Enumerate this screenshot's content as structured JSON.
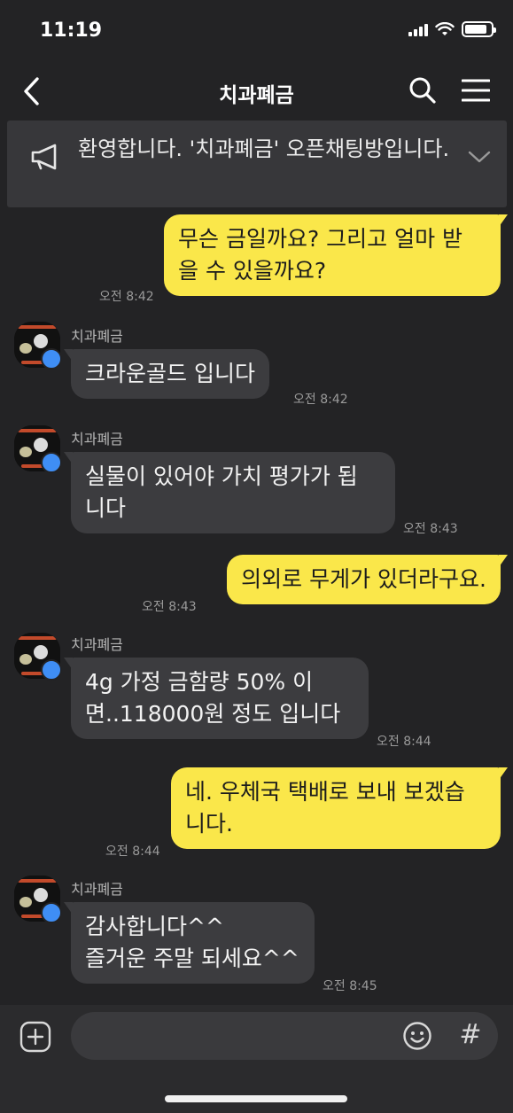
{
  "status_bar": {
    "time": "11:19",
    "battery_level_percent": 85
  },
  "nav": {
    "title": "치과폐금",
    "back_icon": "chevron-left-icon",
    "search_icon": "search-icon",
    "menu_icon": "hamburger-menu-icon"
  },
  "notice": {
    "text": "환영합니다. '치과폐금' 오픈채팅방입니다.",
    "icon": "megaphone-icon",
    "chevron_icon": "chevron-down-icon"
  },
  "messages": [
    {
      "from": "me",
      "text": "무슨 금일까요? 그리고 얼마 받\n을 수 있을까요?",
      "time": "오전 8:42"
    },
    {
      "from": "other",
      "sender": "치과폐금",
      "text": "크라운골드 입니다",
      "time": "오전 8:42"
    },
    {
      "from": "other",
      "sender": "치과폐금",
      "text": "실물이 있어야 가치 평가가 됩\n니다",
      "time": "오전 8:43"
    },
    {
      "from": "me",
      "text": "의외로 무게가 있더라구요.",
      "time": "오전 8:43"
    },
    {
      "from": "other",
      "sender": "치과폐금",
      "text": "4g 가정 금함량 50% 이\n면..118000원 정도 입니다",
      "time": "오전 8:44"
    },
    {
      "from": "me",
      "text": "네. 우체국 택배로 보내 보겠습\n니다.",
      "time": "오전 8:44"
    },
    {
      "from": "other",
      "sender": "치과폐금",
      "text": "감사합니다^^\n즐거운 주말 되세요^^",
      "time": "오전 8:45"
    }
  ],
  "input_bar": {
    "placeholder": "",
    "plus_icon": "plus-icon",
    "emoji_icon": "emoji-icon",
    "hash_label": "#"
  },
  "colors": {
    "background": "#232325",
    "my_bubble": "#fae74a",
    "other_bubble": "#3c3c3f",
    "badge": "#3f8ef5"
  }
}
